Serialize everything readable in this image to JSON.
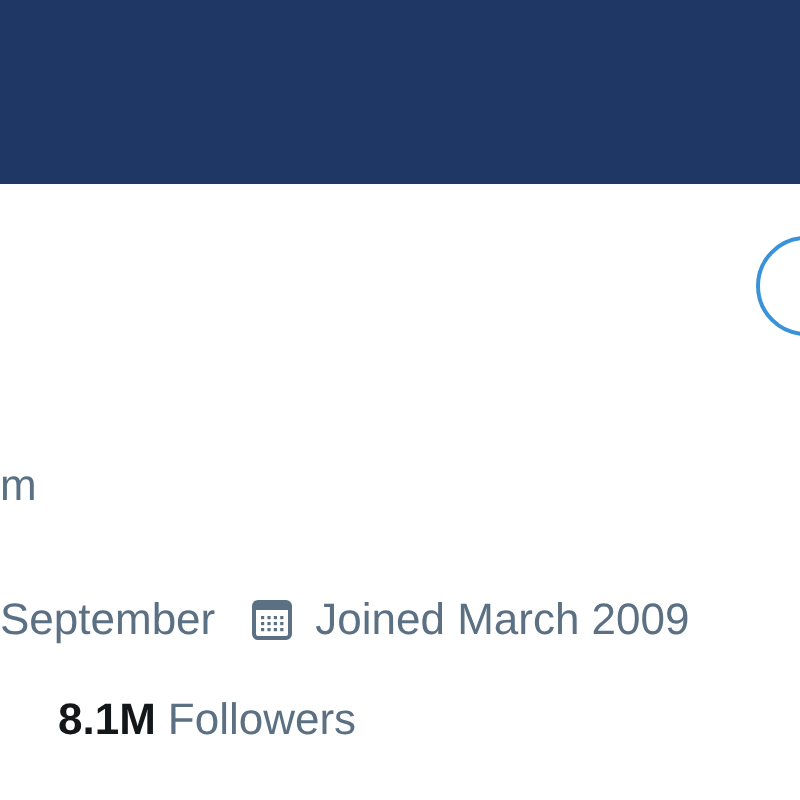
{
  "bio": "m",
  "birthday": "September",
  "joined": "Joined March 2009",
  "followers": {
    "count": "8.1M",
    "label": "Followers"
  }
}
